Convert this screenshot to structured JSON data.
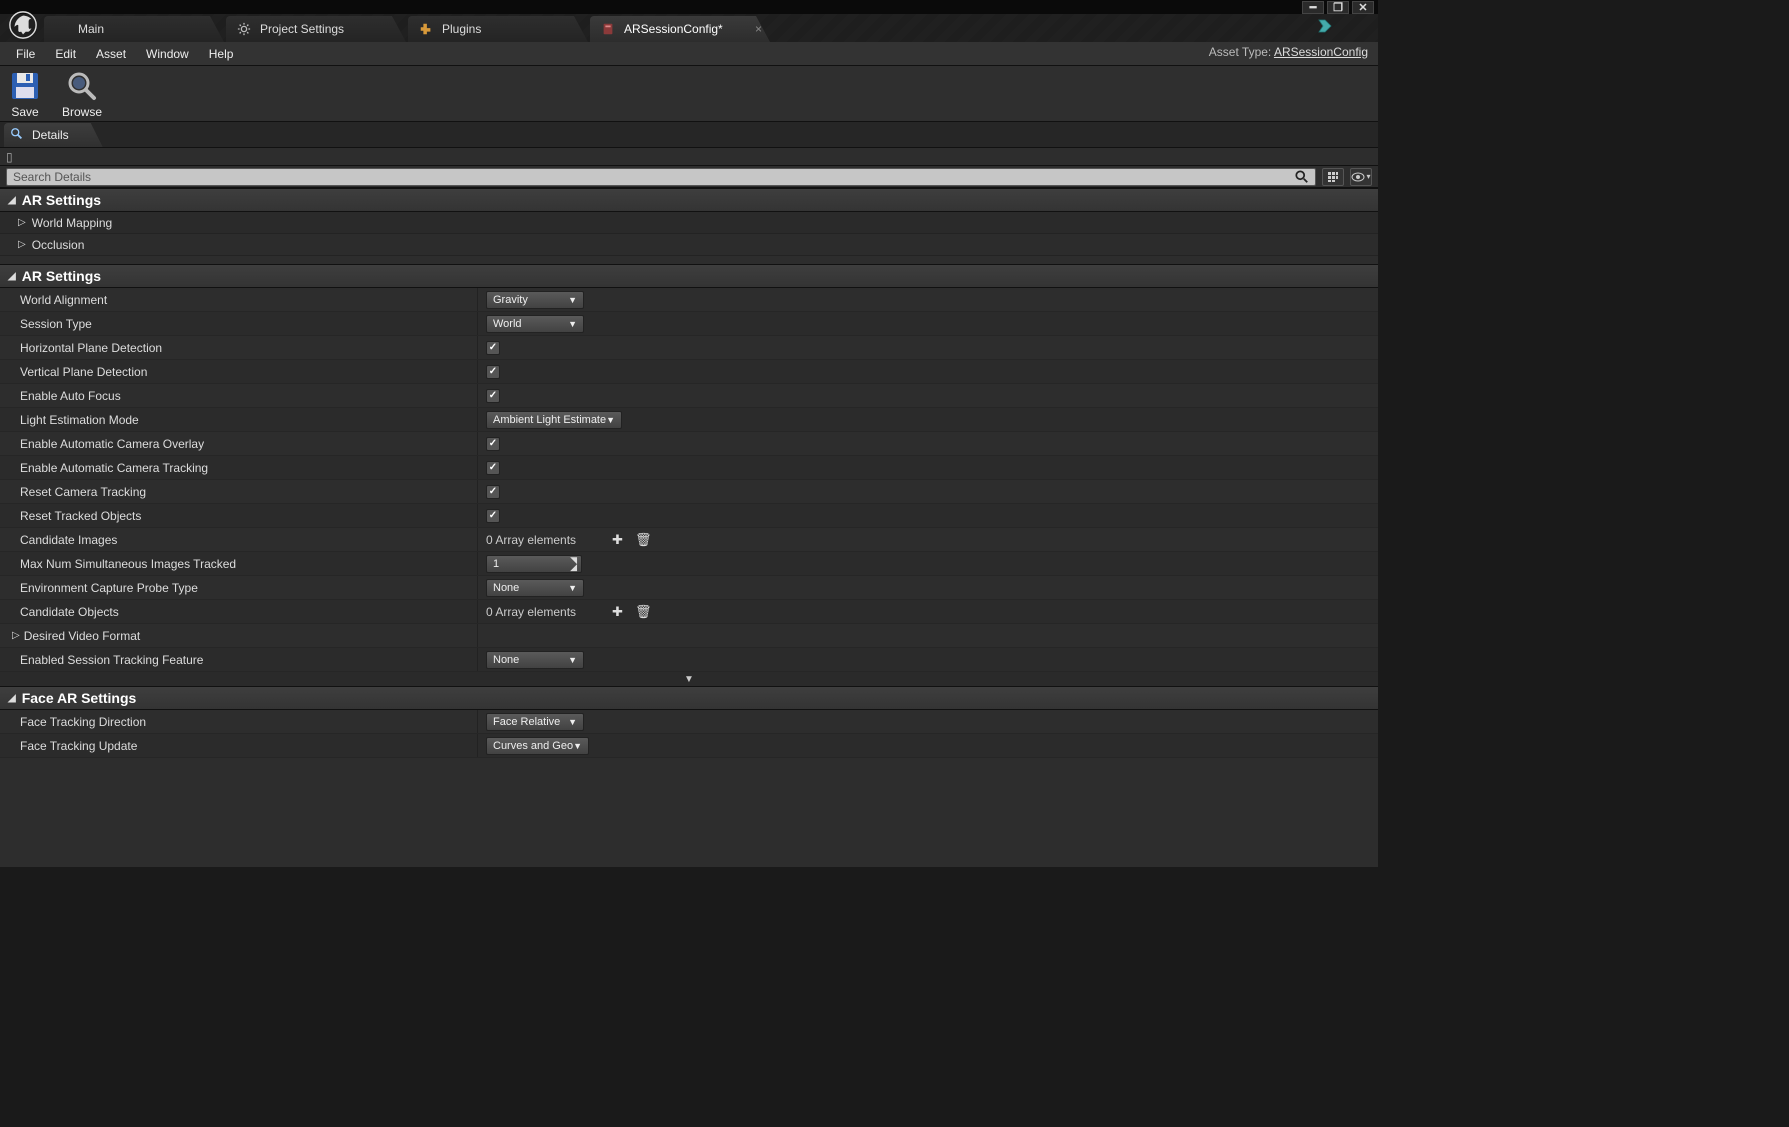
{
  "window": {
    "tabs": [
      {
        "label": "Main"
      },
      {
        "label": "Project Settings"
      },
      {
        "label": "Plugins"
      },
      {
        "label": "ARSessionConfig*"
      }
    ],
    "asset_type_label": "Asset Type:",
    "asset_type_value": "ARSessionConfig"
  },
  "menubar": [
    "File",
    "Edit",
    "Asset",
    "Window",
    "Help"
  ],
  "toolbar": {
    "save": "Save",
    "browse": "Browse"
  },
  "subtab": {
    "label": "Details"
  },
  "search": {
    "placeholder": "Search Details"
  },
  "sections": {
    "ar_settings_1": {
      "title": "AR Settings",
      "rows": [
        {
          "label": "World Mapping"
        },
        {
          "label": "Occlusion"
        }
      ]
    },
    "ar_settings_2": {
      "title": "AR Settings",
      "rows": {
        "world_alignment": {
          "label": "World Alignment",
          "value": "Gravity"
        },
        "session_type": {
          "label": "Session Type",
          "value": "World"
        },
        "hpd": {
          "label": "Horizontal Plane Detection",
          "checked": true
        },
        "vpd": {
          "label": "Vertical Plane Detection",
          "checked": true
        },
        "autofocus": {
          "label": "Enable Auto Focus",
          "checked": true
        },
        "light_est": {
          "label": "Light Estimation Mode",
          "value": "Ambient Light Estimate"
        },
        "cam_overlay": {
          "label": "Enable Automatic Camera Overlay",
          "checked": true
        },
        "cam_tracking": {
          "label": "Enable Automatic Camera Tracking",
          "checked": true
        },
        "reset_cam": {
          "label": "Reset Camera Tracking",
          "checked": true
        },
        "reset_tracked": {
          "label": "Reset Tracked Objects",
          "checked": true
        },
        "cand_images": {
          "label": "Candidate Images",
          "array_text": "0 Array elements"
        },
        "max_tracked": {
          "label": "Max Num Simultaneous Images Tracked",
          "value": "1"
        },
        "env_probe": {
          "label": "Environment Capture Probe Type",
          "value": "None"
        },
        "cand_objects": {
          "label": "Candidate Objects",
          "array_text": "0 Array elements"
        },
        "video_format": {
          "label": "Desired Video Format"
        },
        "tracking_feature": {
          "label": "Enabled Session Tracking Feature",
          "value": "None"
        }
      }
    },
    "face_ar": {
      "title": "Face AR Settings",
      "rows": {
        "direction": {
          "label": "Face Tracking Direction",
          "value": "Face Relative"
        },
        "update": {
          "label": "Face Tracking Update",
          "value": "Curves and Geo"
        }
      }
    }
  }
}
